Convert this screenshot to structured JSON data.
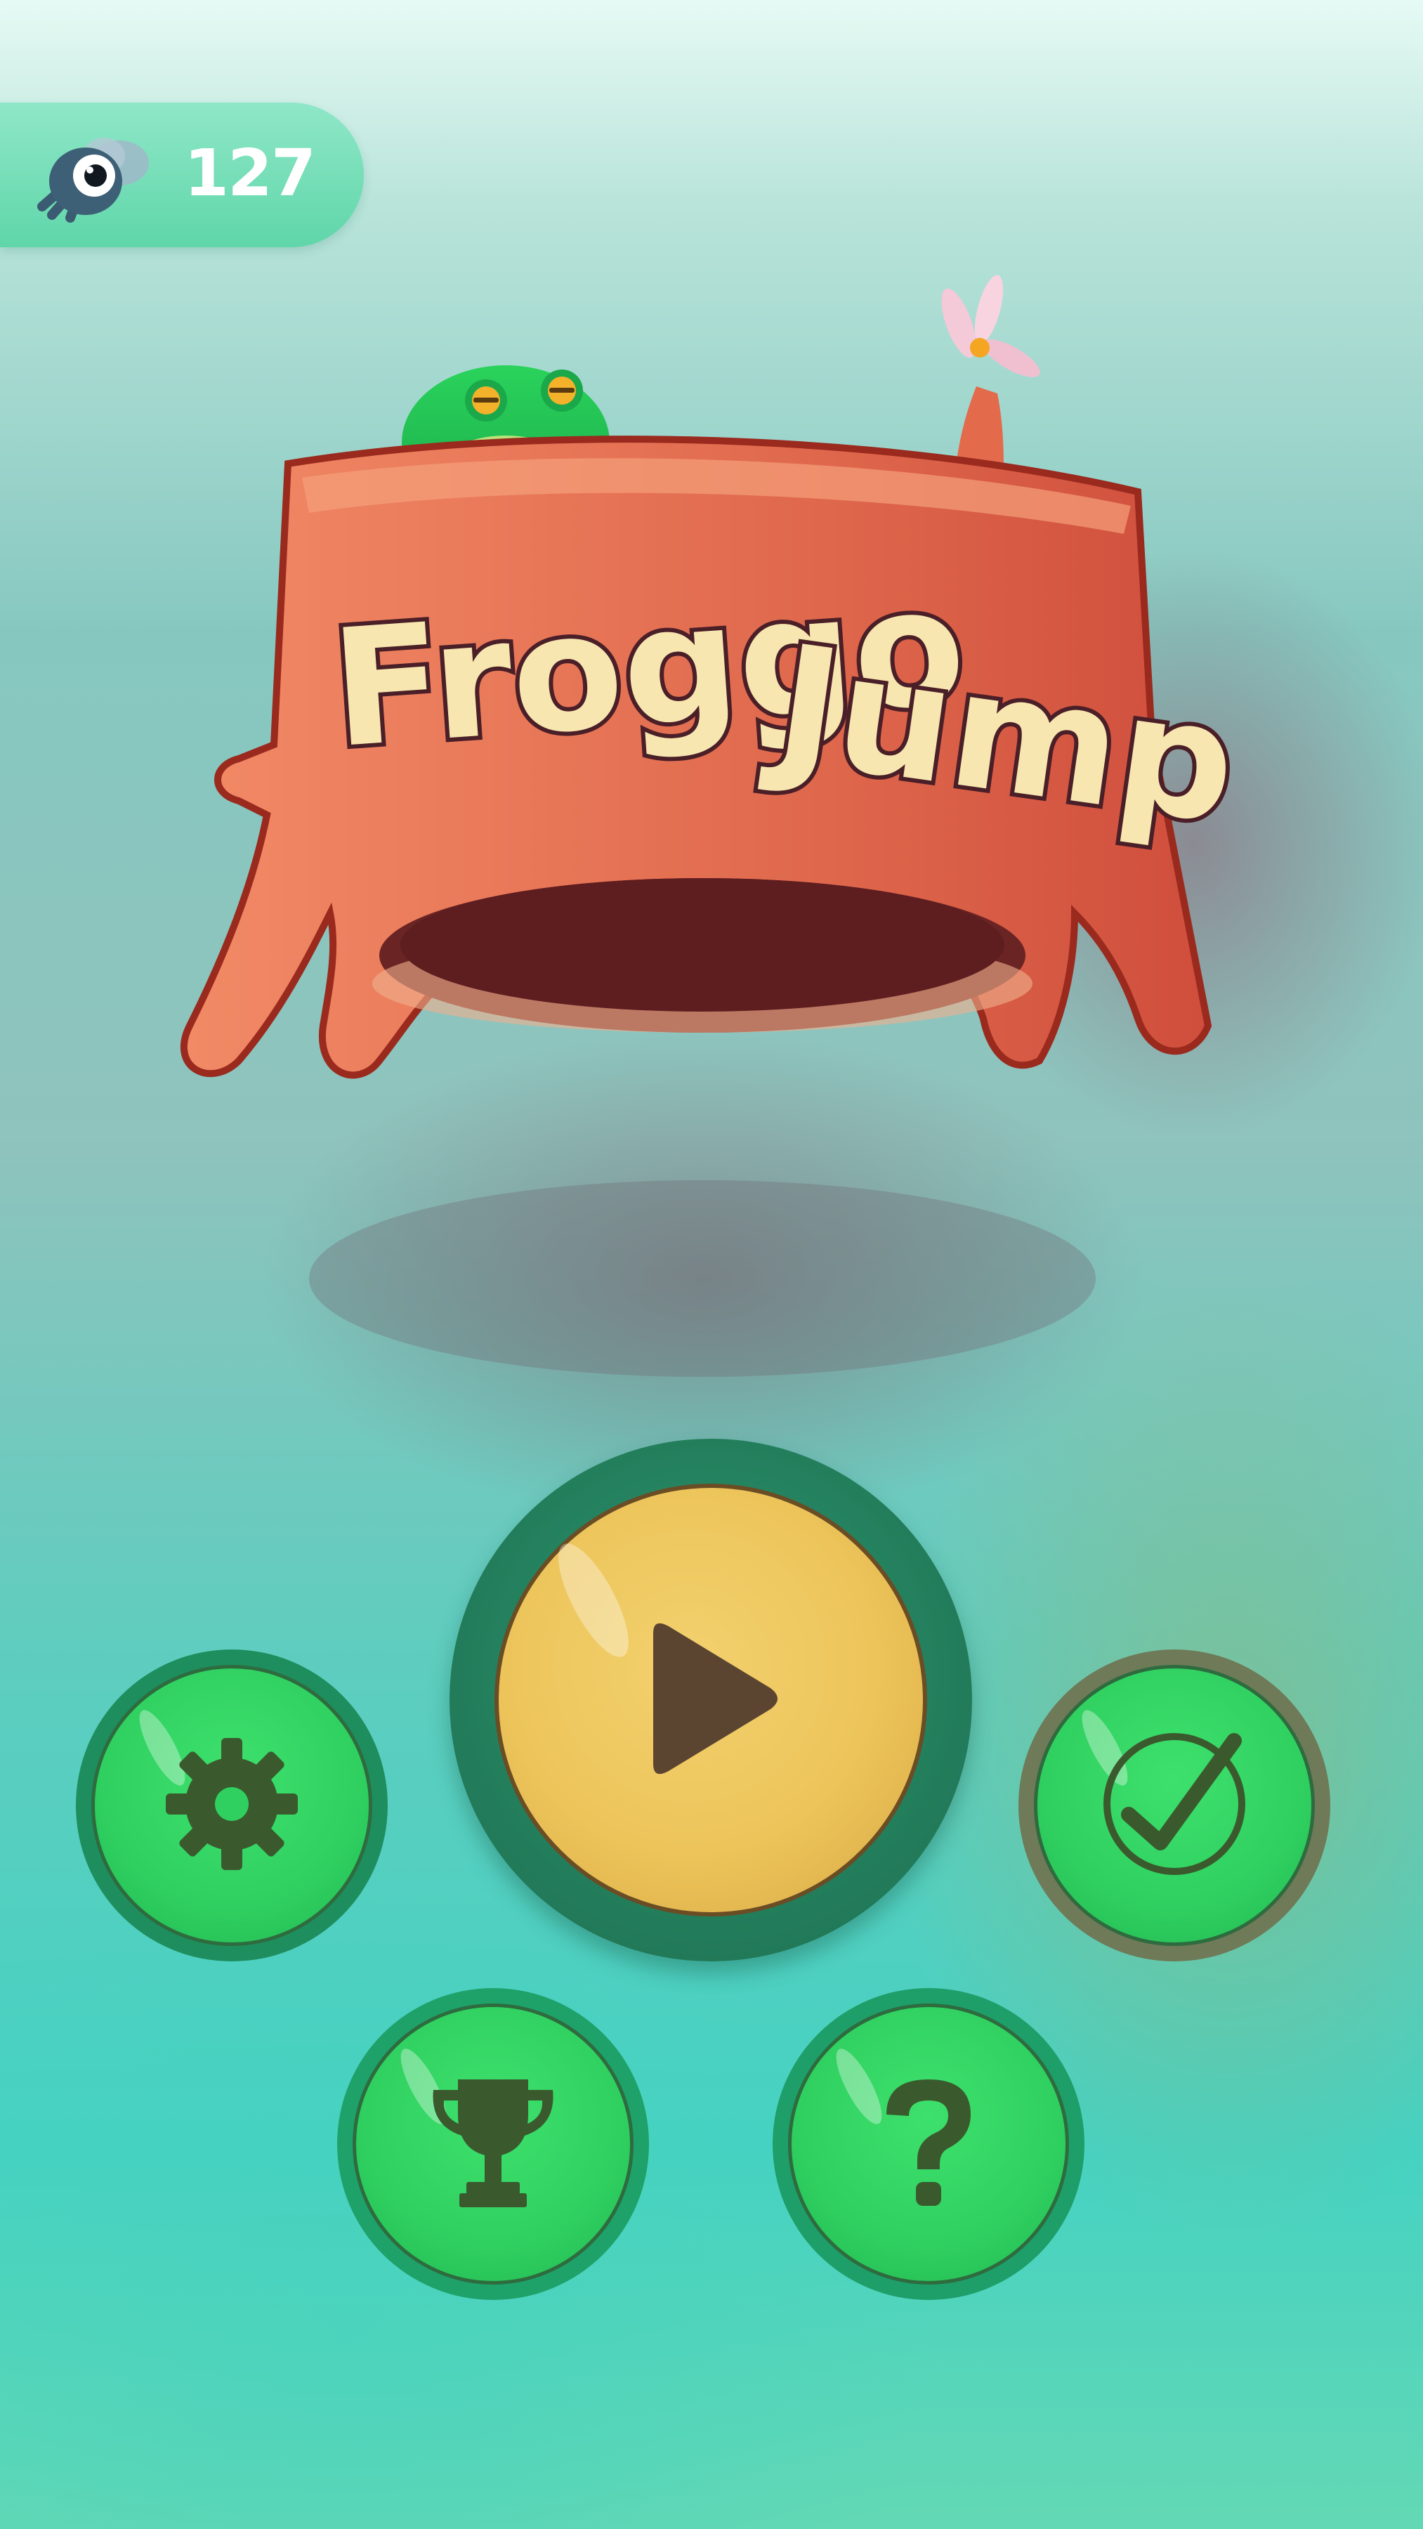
{
  "hud": {
    "currency_icon": "fly-icon",
    "score": "127"
  },
  "logo": {
    "title_word_1": "Froggo",
    "title_word_2": "Jump",
    "decorations": [
      "frog-icon",
      "flower-icon",
      "tree-stump"
    ]
  },
  "menu": {
    "play_icon": "play-icon",
    "settings_icon": "gear-icon",
    "achievements_icon": "checkmark-icon",
    "leaderboard_icon": "trophy-icon",
    "help_icon": "question-mark-icon"
  },
  "colors": {
    "play_button": "#ecc45a",
    "menu_button": "#2fd060",
    "icon_dark": "#3a5a2e",
    "stump": "#e27757",
    "score_pill": "#6edcb3"
  }
}
